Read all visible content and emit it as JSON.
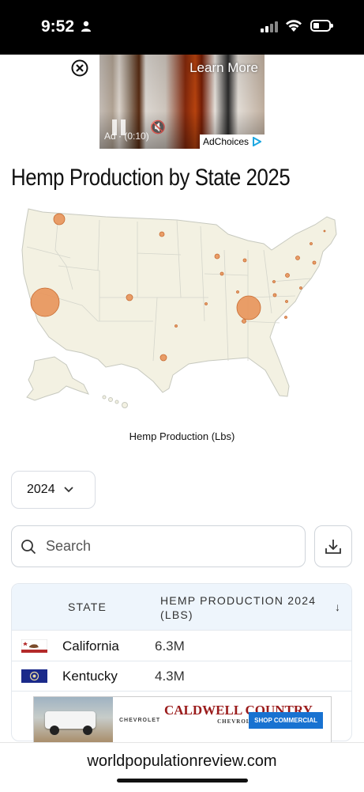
{
  "status_bar": {
    "time": "9:52"
  },
  "ad_top": {
    "learn_more": "Learn More",
    "timer": "Ad · (0:10)",
    "adchoices": "AdChoices"
  },
  "page": {
    "title": "Hemp Production by State 2025"
  },
  "map": {
    "caption": "Hemp Production (Lbs)",
    "bubble_color": "#E8935A",
    "land_color": "#F3F1E2"
  },
  "controls": {
    "year_selected": "2024",
    "search_placeholder": "Search"
  },
  "table": {
    "headers": {
      "state": "STATE",
      "production": "HEMP PRODUCTION 2024 (LBS)",
      "sort_icon": "arrow-down-icon"
    },
    "rows": [
      {
        "state": "California",
        "value": "6.3M",
        "flag": "california-flag-icon"
      },
      {
        "state": "Kentucky",
        "value": "4.3M",
        "flag": "kentucky-flag-icon"
      }
    ]
  },
  "ad_bottom": {
    "brand": "CHEVROLET",
    "dealer": "CALDWELL COUNTRY",
    "dealer_sub": "CHEVROLET",
    "cta": "SHOP COMMERCIAL"
  },
  "footer": {
    "domain": "worldpopulationreview.com"
  }
}
